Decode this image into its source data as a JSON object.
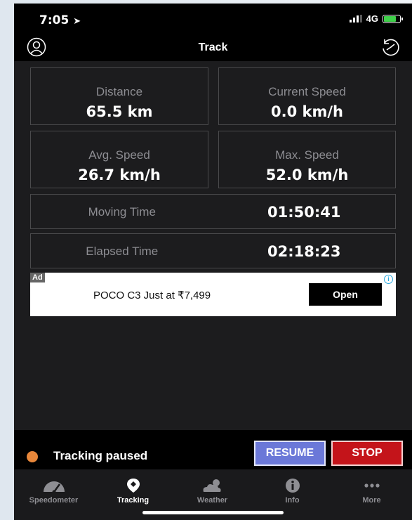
{
  "status_bar": {
    "time": "7:05",
    "network": "4G"
  },
  "nav": {
    "title": "Track"
  },
  "stats": {
    "distance": {
      "label": "Distance",
      "value": "65.5 km"
    },
    "current_speed": {
      "label": "Current Speed",
      "value": "0.0 km/h"
    },
    "avg_speed": {
      "label": "Avg. Speed",
      "value": "26.7 km/h"
    },
    "max_speed": {
      "label": "Max. Speed",
      "value": "52.0 km/h"
    },
    "moving_time": {
      "label": "Moving Time",
      "value": "01:50:41"
    },
    "elapsed_time": {
      "label": "Elapsed Time",
      "value": "02:18:23"
    }
  },
  "ad": {
    "tag": "Ad",
    "text": "POCO C3 Just at ₹7,499",
    "button": "Open"
  },
  "tracking": {
    "status": "Tracking paused",
    "resume_label": "RESUME",
    "stop_label": "STOP"
  },
  "tabs": [
    {
      "label": "Speedometer",
      "icon": "speedometer-icon"
    },
    {
      "label": "Tracking",
      "icon": "location-pin-icon"
    },
    {
      "label": "Weather",
      "icon": "weather-icon"
    },
    {
      "label": "Info",
      "icon": "info-icon"
    },
    {
      "label": "More",
      "icon": "more-icon"
    }
  ],
  "colors": {
    "accent_resume": "#6b78d8",
    "accent_stop": "#c4141a",
    "paused_dot": "#e8873a",
    "battery": "#3fd14a"
  }
}
